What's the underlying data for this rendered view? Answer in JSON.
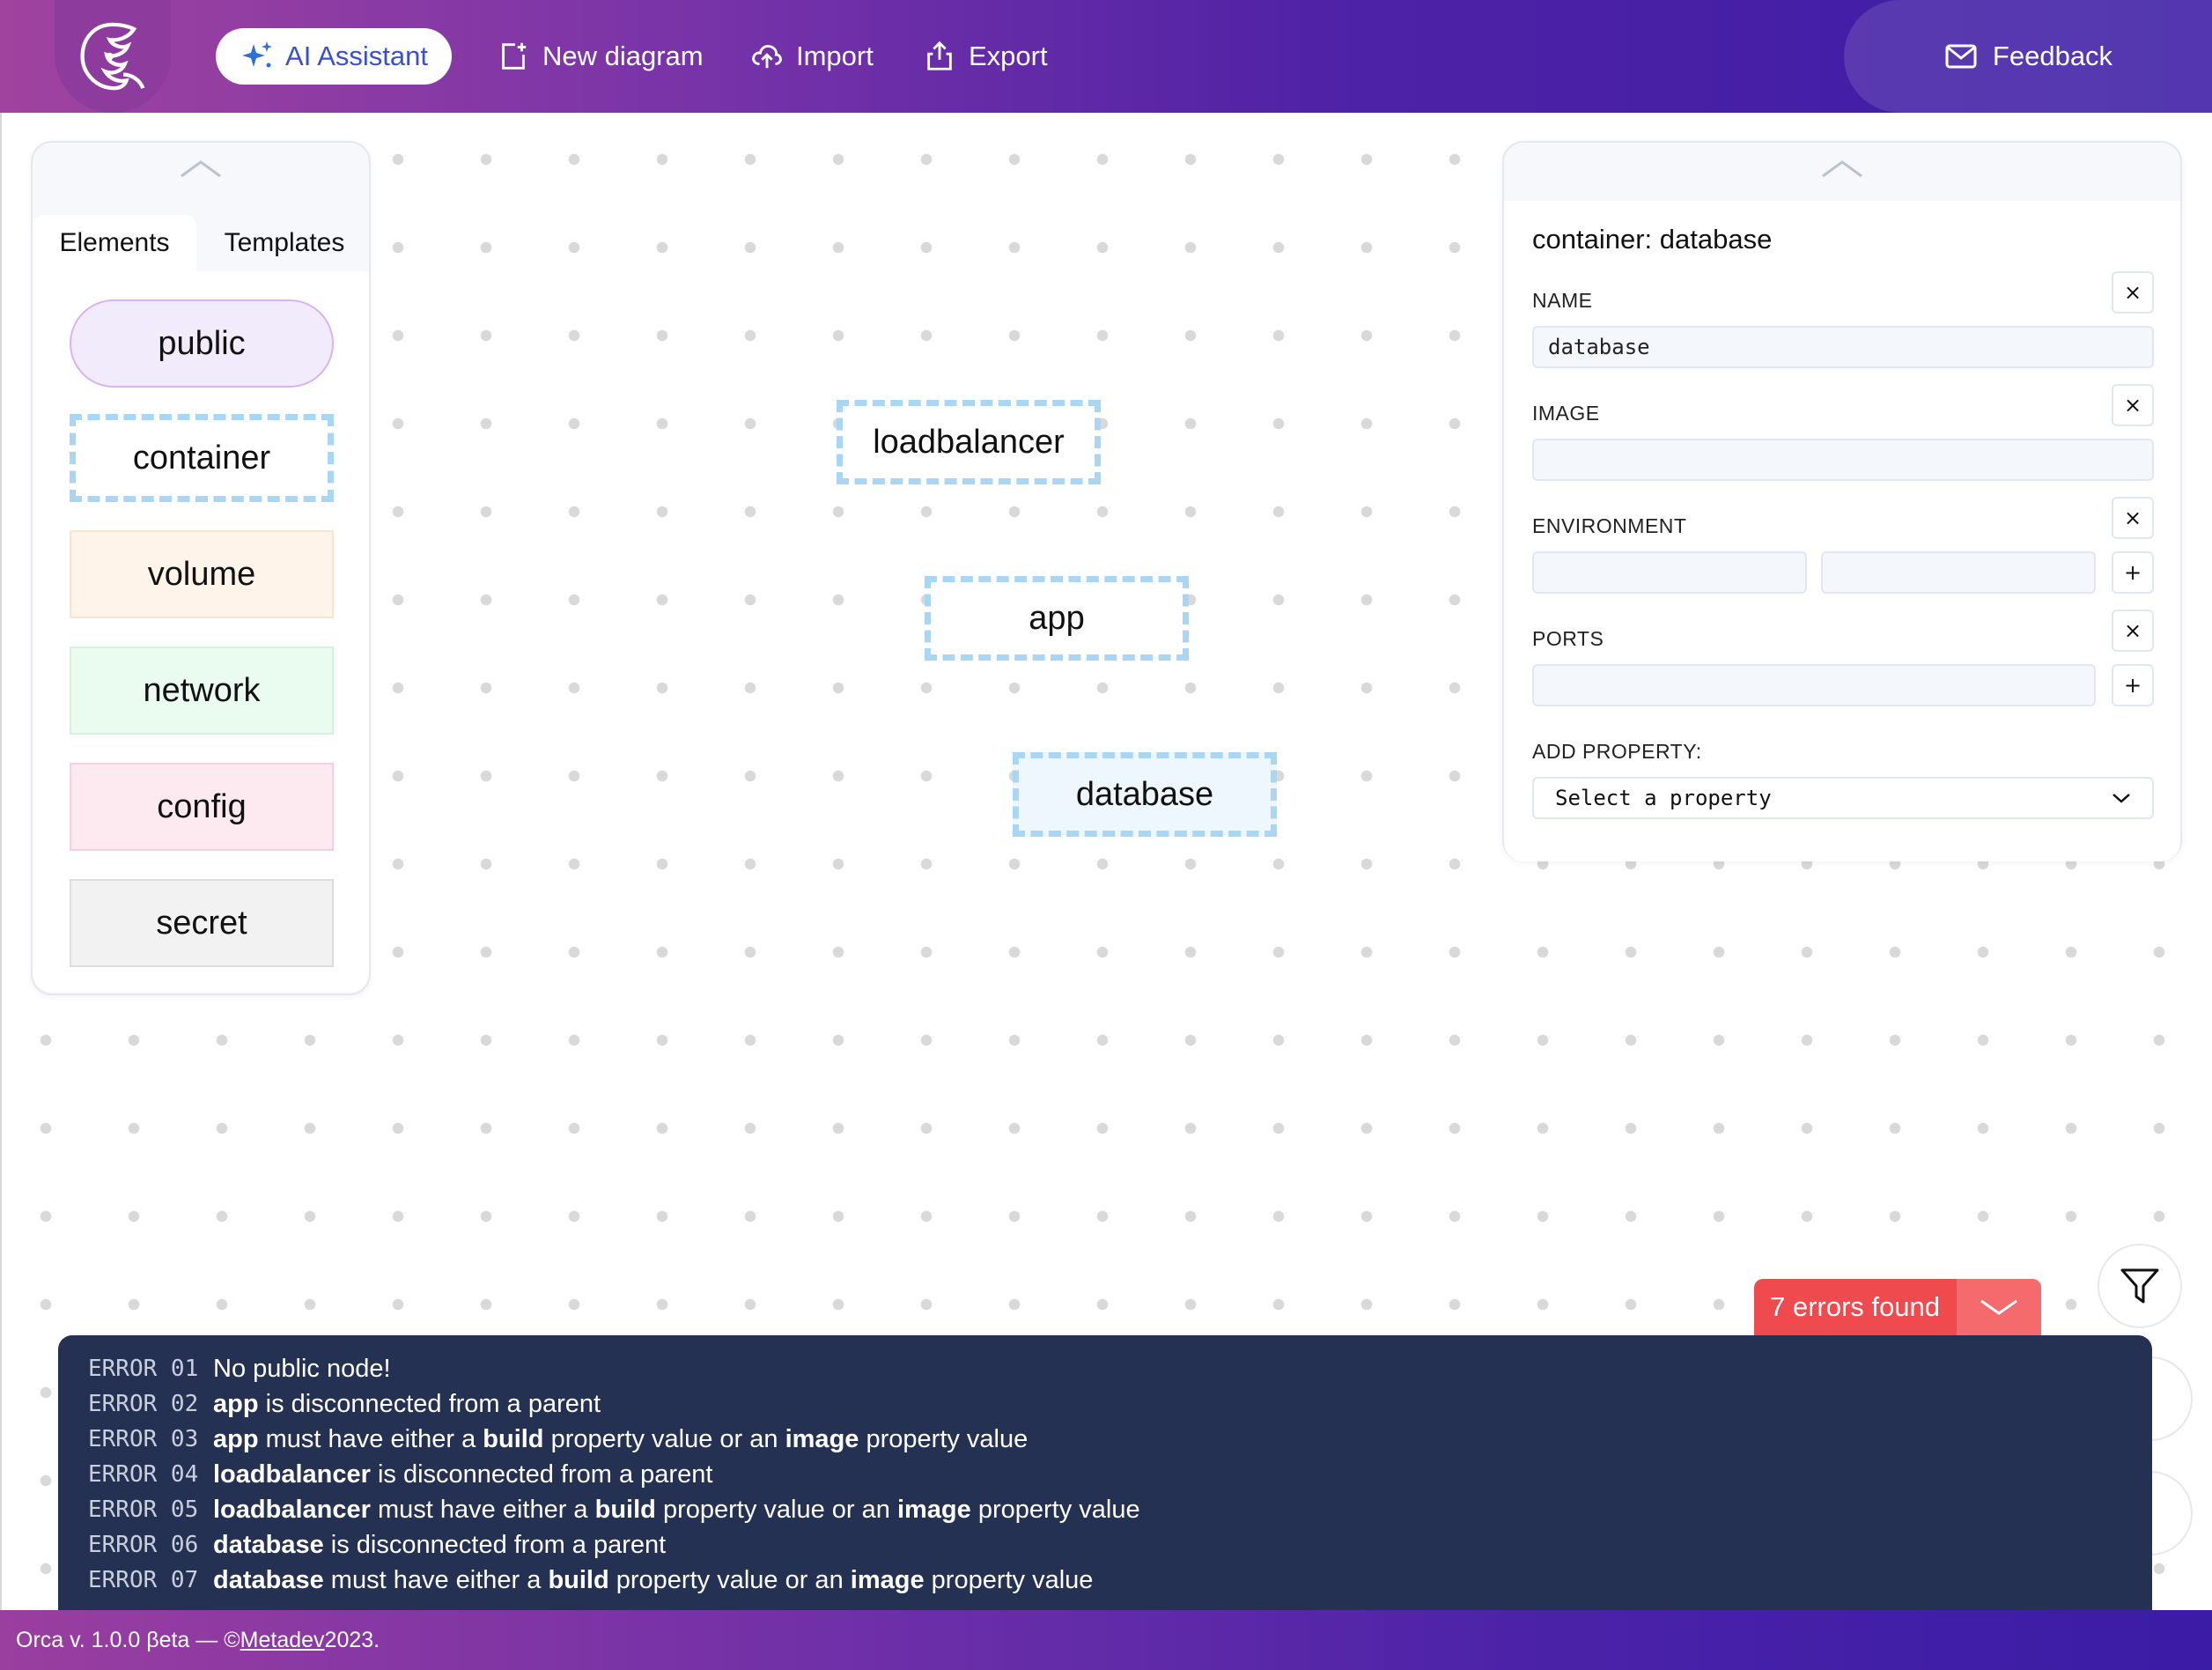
{
  "header": {
    "ai_assistant_label": "AI Assistant",
    "new_diagram_label": "New diagram",
    "import_label": "Import",
    "export_label": "Export",
    "feedback_label": "Feedback"
  },
  "left_panel": {
    "tabs": [
      "Elements",
      "Templates"
    ],
    "active_tab": "Elements",
    "elements": [
      "public",
      "container",
      "volume",
      "network",
      "config",
      "secret"
    ]
  },
  "diagram": {
    "nodes": [
      "loadbalancer",
      "app",
      "database"
    ],
    "selected": "database"
  },
  "right_panel": {
    "title": "container: database",
    "fields": {
      "name_label": "NAME",
      "name_value": "database",
      "image_label": "IMAGE",
      "image_value": "",
      "environment_label": "ENVIRONMENT",
      "ports_label": "PORTS",
      "add_property_label": "ADD PROPERTY:",
      "add_property_select": "Select a property"
    },
    "remove_symbol": "×",
    "add_symbol": "+"
  },
  "errors": {
    "summary": "7 errors found",
    "items": [
      {
        "code": "ERROR 01",
        "text": "No public node!"
      },
      {
        "code": "ERROR 02",
        "subject": "app",
        "text": "is disconnected from a parent"
      },
      {
        "code": "ERROR 03",
        "subject": "app",
        "text_a": "must have either a",
        "kw1": "build",
        "text_b": "property value or an",
        "kw2": "image",
        "text_c": "property value"
      },
      {
        "code": "ERROR 04",
        "subject": "loadbalancer",
        "text": "is disconnected from a parent"
      },
      {
        "code": "ERROR 05",
        "subject": "loadbalancer",
        "text_a": "must have either a",
        "kw1": "build",
        "text_b": "property value or an",
        "kw2": "image",
        "text_c": "property value"
      },
      {
        "code": "ERROR 06",
        "subject": "database",
        "text": "is disconnected from a parent"
      },
      {
        "code": "ERROR 07",
        "subject": "database",
        "text_a": "must have either a",
        "kw1": "build",
        "text_b": "property value or an",
        "kw2": "image",
        "text_c": "property value"
      }
    ]
  },
  "footer": {
    "prefix": "Orca v. 1.0.0 βeta — © ",
    "link": "Metadev",
    "suffix": " 2023."
  },
  "colors": {
    "accent": "#3a50c8",
    "error": "#ef4a4d",
    "error_panel": "#243152",
    "node_border": "#a8d6f3"
  },
  "icons": {
    "logo": "orca-logo-icon",
    "ai": "sparkles-icon",
    "new": "new-file-icon",
    "import": "cloud-upload-icon",
    "export": "share-upload-icon",
    "feedback": "mail-icon",
    "filter": "filter-icon"
  }
}
